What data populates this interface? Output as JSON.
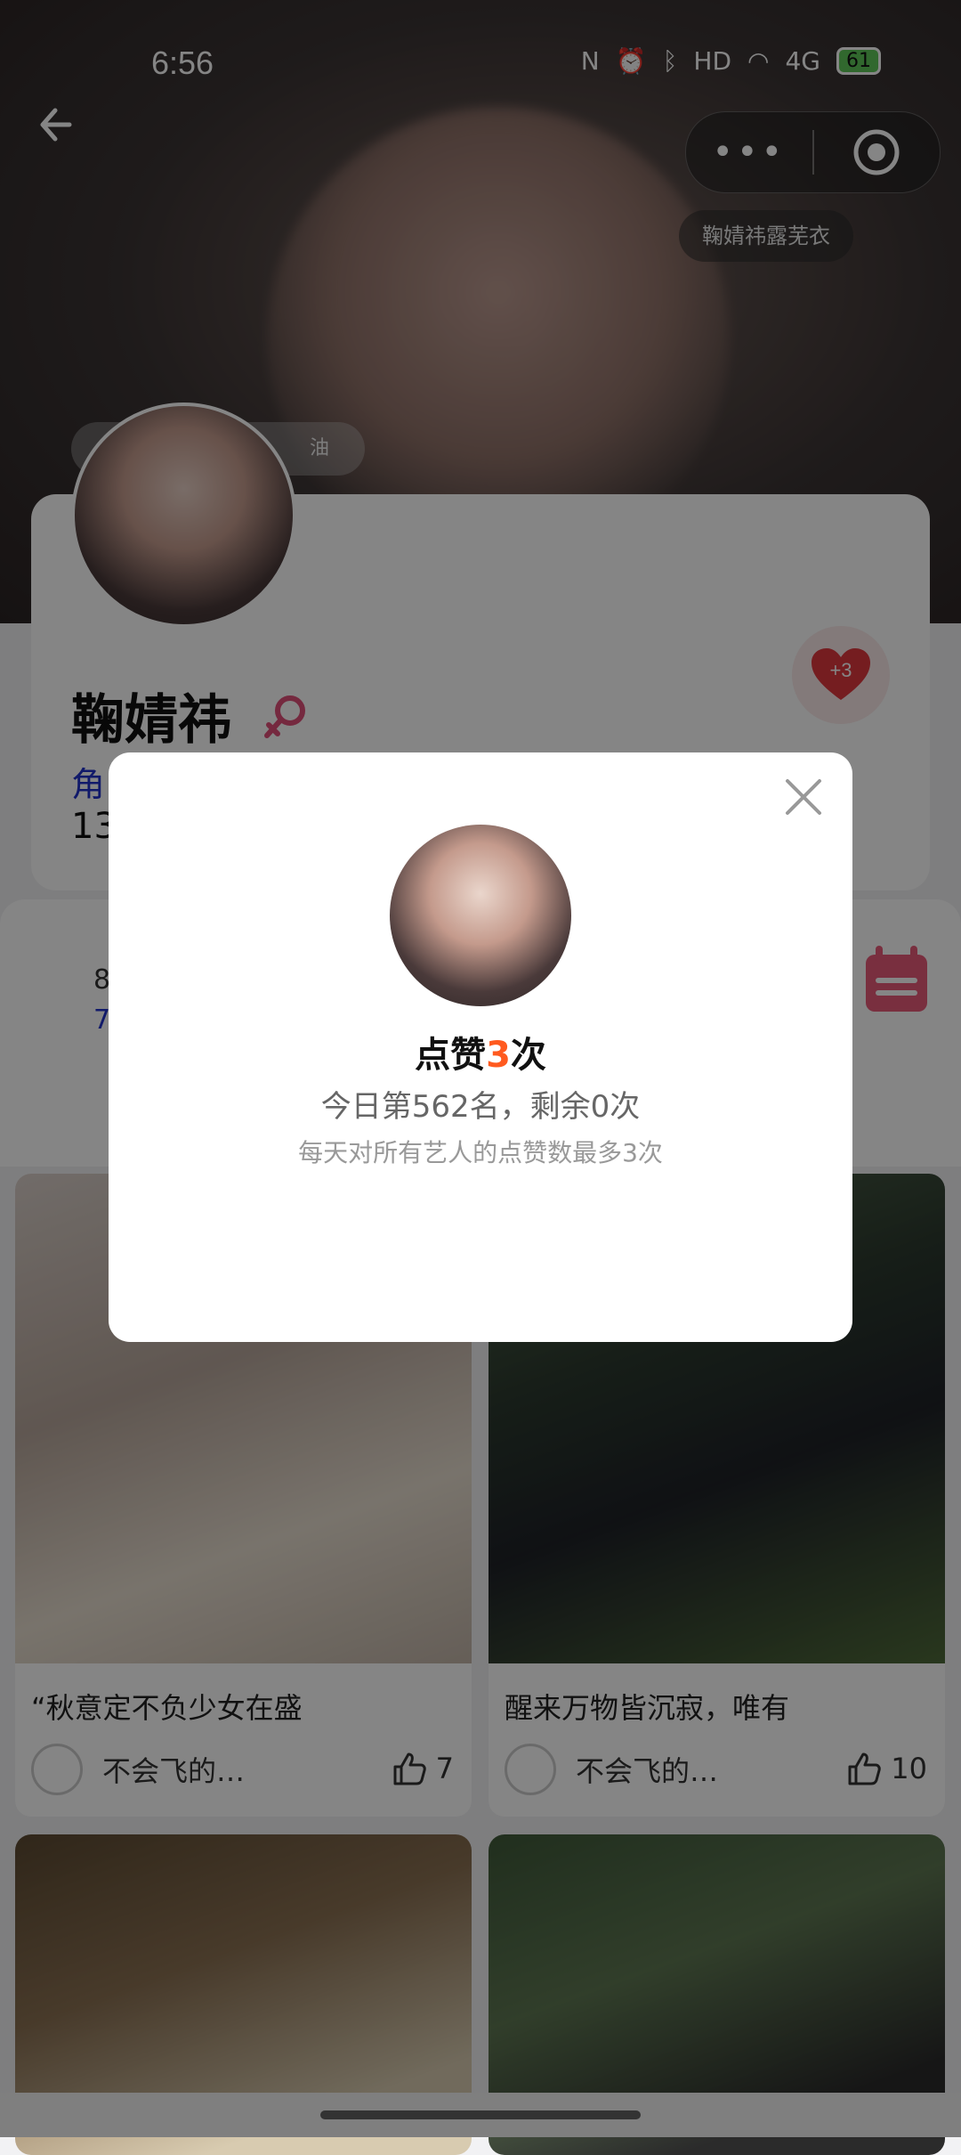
{
  "status": {
    "time": "6:56",
    "battery": "61",
    "network": "4G",
    "hd": "HD"
  },
  "header": {
    "more_label": "•••",
    "artist_chip": "鞠婧祎露芜衣"
  },
  "fan_chip": {
    "text": "油"
  },
  "profile": {
    "name": "鞠婧祎",
    "role_prefix": "角",
    "number_prefix": "13",
    "like_badge": "+3"
  },
  "stats": {
    "line1": "8",
    "line2": "7"
  },
  "posts": [
    {
      "title": "“秋意定不负少女在盛",
      "author": "不会飞的…",
      "likes": "7"
    },
    {
      "title": "醒来万物皆沉寂，唯有",
      "author": "不会飞的…",
      "likes": "10"
    }
  ],
  "modal": {
    "title_prefix": "点赞",
    "title_count": "3",
    "title_suffix": "次",
    "rank_line": "今日第562名，剩余0次",
    "note": "每天对所有艺人的点赞数最多3次"
  },
  "colors": {
    "accent": "#ff5a1f",
    "like_red": "#e0383f",
    "link_blue": "#2233cc"
  }
}
